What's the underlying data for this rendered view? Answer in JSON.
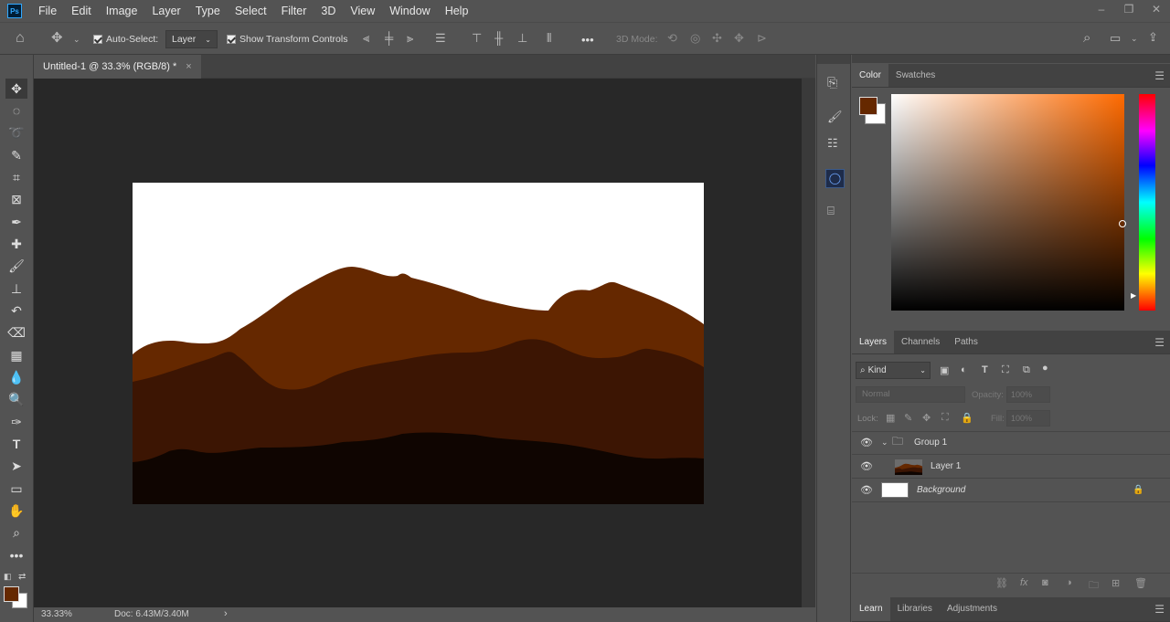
{
  "menubar": {
    "logo": "Ps",
    "items": [
      "File",
      "Edit",
      "Image",
      "Layer",
      "Type",
      "Select",
      "Filter",
      "3D",
      "View",
      "Window",
      "Help"
    ],
    "window_buttons": [
      "minimize-icon",
      "restore-icon",
      "close-icon"
    ]
  },
  "options": {
    "auto_select_label": "Auto-Select:",
    "auto_select_checked": true,
    "target_dropdown": "Layer",
    "transform_label": "Show Transform Controls",
    "transform_checked": true,
    "mode_3d_label": "3D Mode:",
    "more_label": "•••"
  },
  "document": {
    "tab_title": "Untitled-1 @ 33.3% (RGB/8) *",
    "tab_close": "×"
  },
  "status": {
    "zoom": "33.33%",
    "doc_info": "Doc: 6.43M/3.40M",
    "arrow": "›"
  },
  "colors": {
    "foreground": "#652800",
    "background": "#ffffff",
    "sky": "#ffffff",
    "layer_far": "#652800",
    "layer_mid": "#3c1503",
    "layer_near": "#0f0501"
  },
  "color_panel": {
    "tabs": [
      "Color",
      "Swatches"
    ],
    "active_tab": "Color",
    "hue_color": "#ff6a00"
  },
  "layers_panel": {
    "tabs": [
      "Layers",
      "Channels",
      "Paths"
    ],
    "active_tab": "Layers",
    "filter_kind": "Kind",
    "blend_mode": "Normal",
    "opacity_label": "Opacity:",
    "opacity_value": "100%",
    "lock_label": "Lock:",
    "fill_label": "Fill:",
    "fill_value": "100%",
    "layers": [
      {
        "name": "Group 1",
        "type": "group",
        "visible": true
      },
      {
        "name": "Layer 1",
        "type": "layer",
        "visible": true
      },
      {
        "name": "Background",
        "type": "background",
        "visible": true,
        "locked": true
      }
    ]
  },
  "bottom_panel": {
    "tabs": [
      "Learn",
      "Libraries",
      "Adjustments"
    ],
    "active_tab": "Learn"
  }
}
